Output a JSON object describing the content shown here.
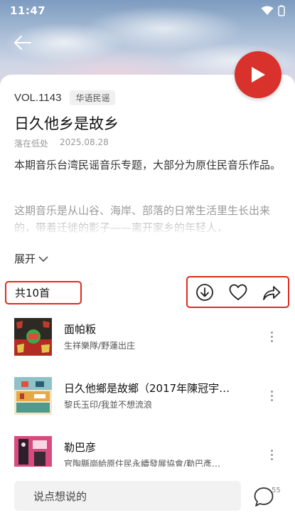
{
  "status_bar": {
    "time": "11:47"
  },
  "album": {
    "vol": "VOL.1143",
    "tag": "华语民谣",
    "title": "日久他乡是故乡",
    "author": "落在低处",
    "date": "2025.08.28",
    "desc1": "本期音乐台湾民谣音乐专题，大部分为原住民音乐作品。",
    "desc2": "这期音乐是从山谷、海岸、部落的日常生活里生长出来的，带着迁徙的影子——离开家乡的年轻人，",
    "expand_label": "展开"
  },
  "list": {
    "count_label": "共10首",
    "tracks": [
      {
        "title": "面帕粄",
        "subtitle": "生祥樂隊/野蓮出庄"
      },
      {
        "title": "日久他鄉是故鄉（2017年陳冠宇…",
        "subtitle": "黎氏玉印/我並不想流浪"
      },
      {
        "title": "勒巴彦",
        "subtitle": "官陶縣崗給原住民永續發展協會/勒巴彥…"
      }
    ]
  },
  "bottom": {
    "comment_placeholder": "说点想说的",
    "comment_count": "55"
  },
  "colors": {
    "accent": "#d9312b",
    "highlight_box": "#e02b1c"
  }
}
